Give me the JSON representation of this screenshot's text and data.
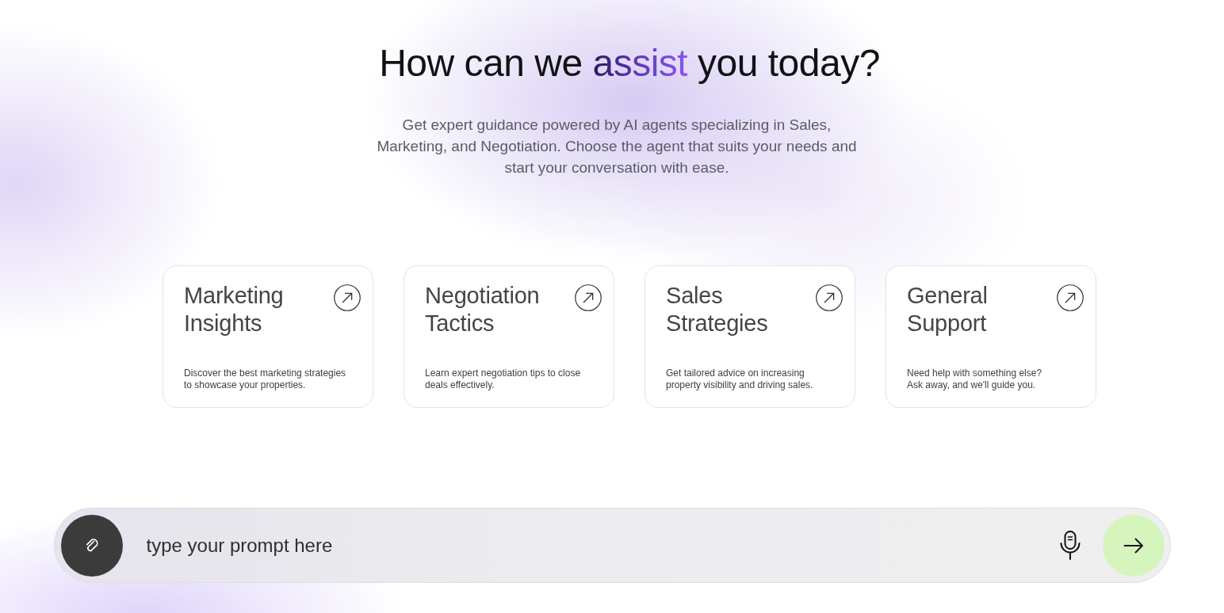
{
  "heading": {
    "parts": [
      {
        "text": "How can we",
        "highlight": false
      },
      {
        "text": "assist",
        "highlight": true
      },
      {
        "text": "you today?",
        "highlight": false
      }
    ]
  },
  "subtitle": "Get expert guidance powered by AI agents specializing in Sales, Marketing, and Negotiation. Choose the agent that suits your needs and start your conversation with ease.",
  "agent_cards": [
    {
      "title": "Marketing Insights",
      "description": [
        "Discover the best marketing strategies",
        "to showcase your properties."
      ]
    },
    {
      "title": "Negotiation Tactics",
      "description": [
        "Learn expert negotiation tips to close",
        "deals effectively."
      ]
    },
    {
      "title": "Sales Strategies",
      "description": [
        "Get tailored advice on increasing",
        "property visibility and driving sales."
      ]
    },
    {
      "title": "General Support",
      "description": [
        "Need help with something else?",
        "Ask away, and we'll guide you."
      ]
    }
  ],
  "prompt_bar": {
    "placeholder": "type your prompt here"
  }
}
